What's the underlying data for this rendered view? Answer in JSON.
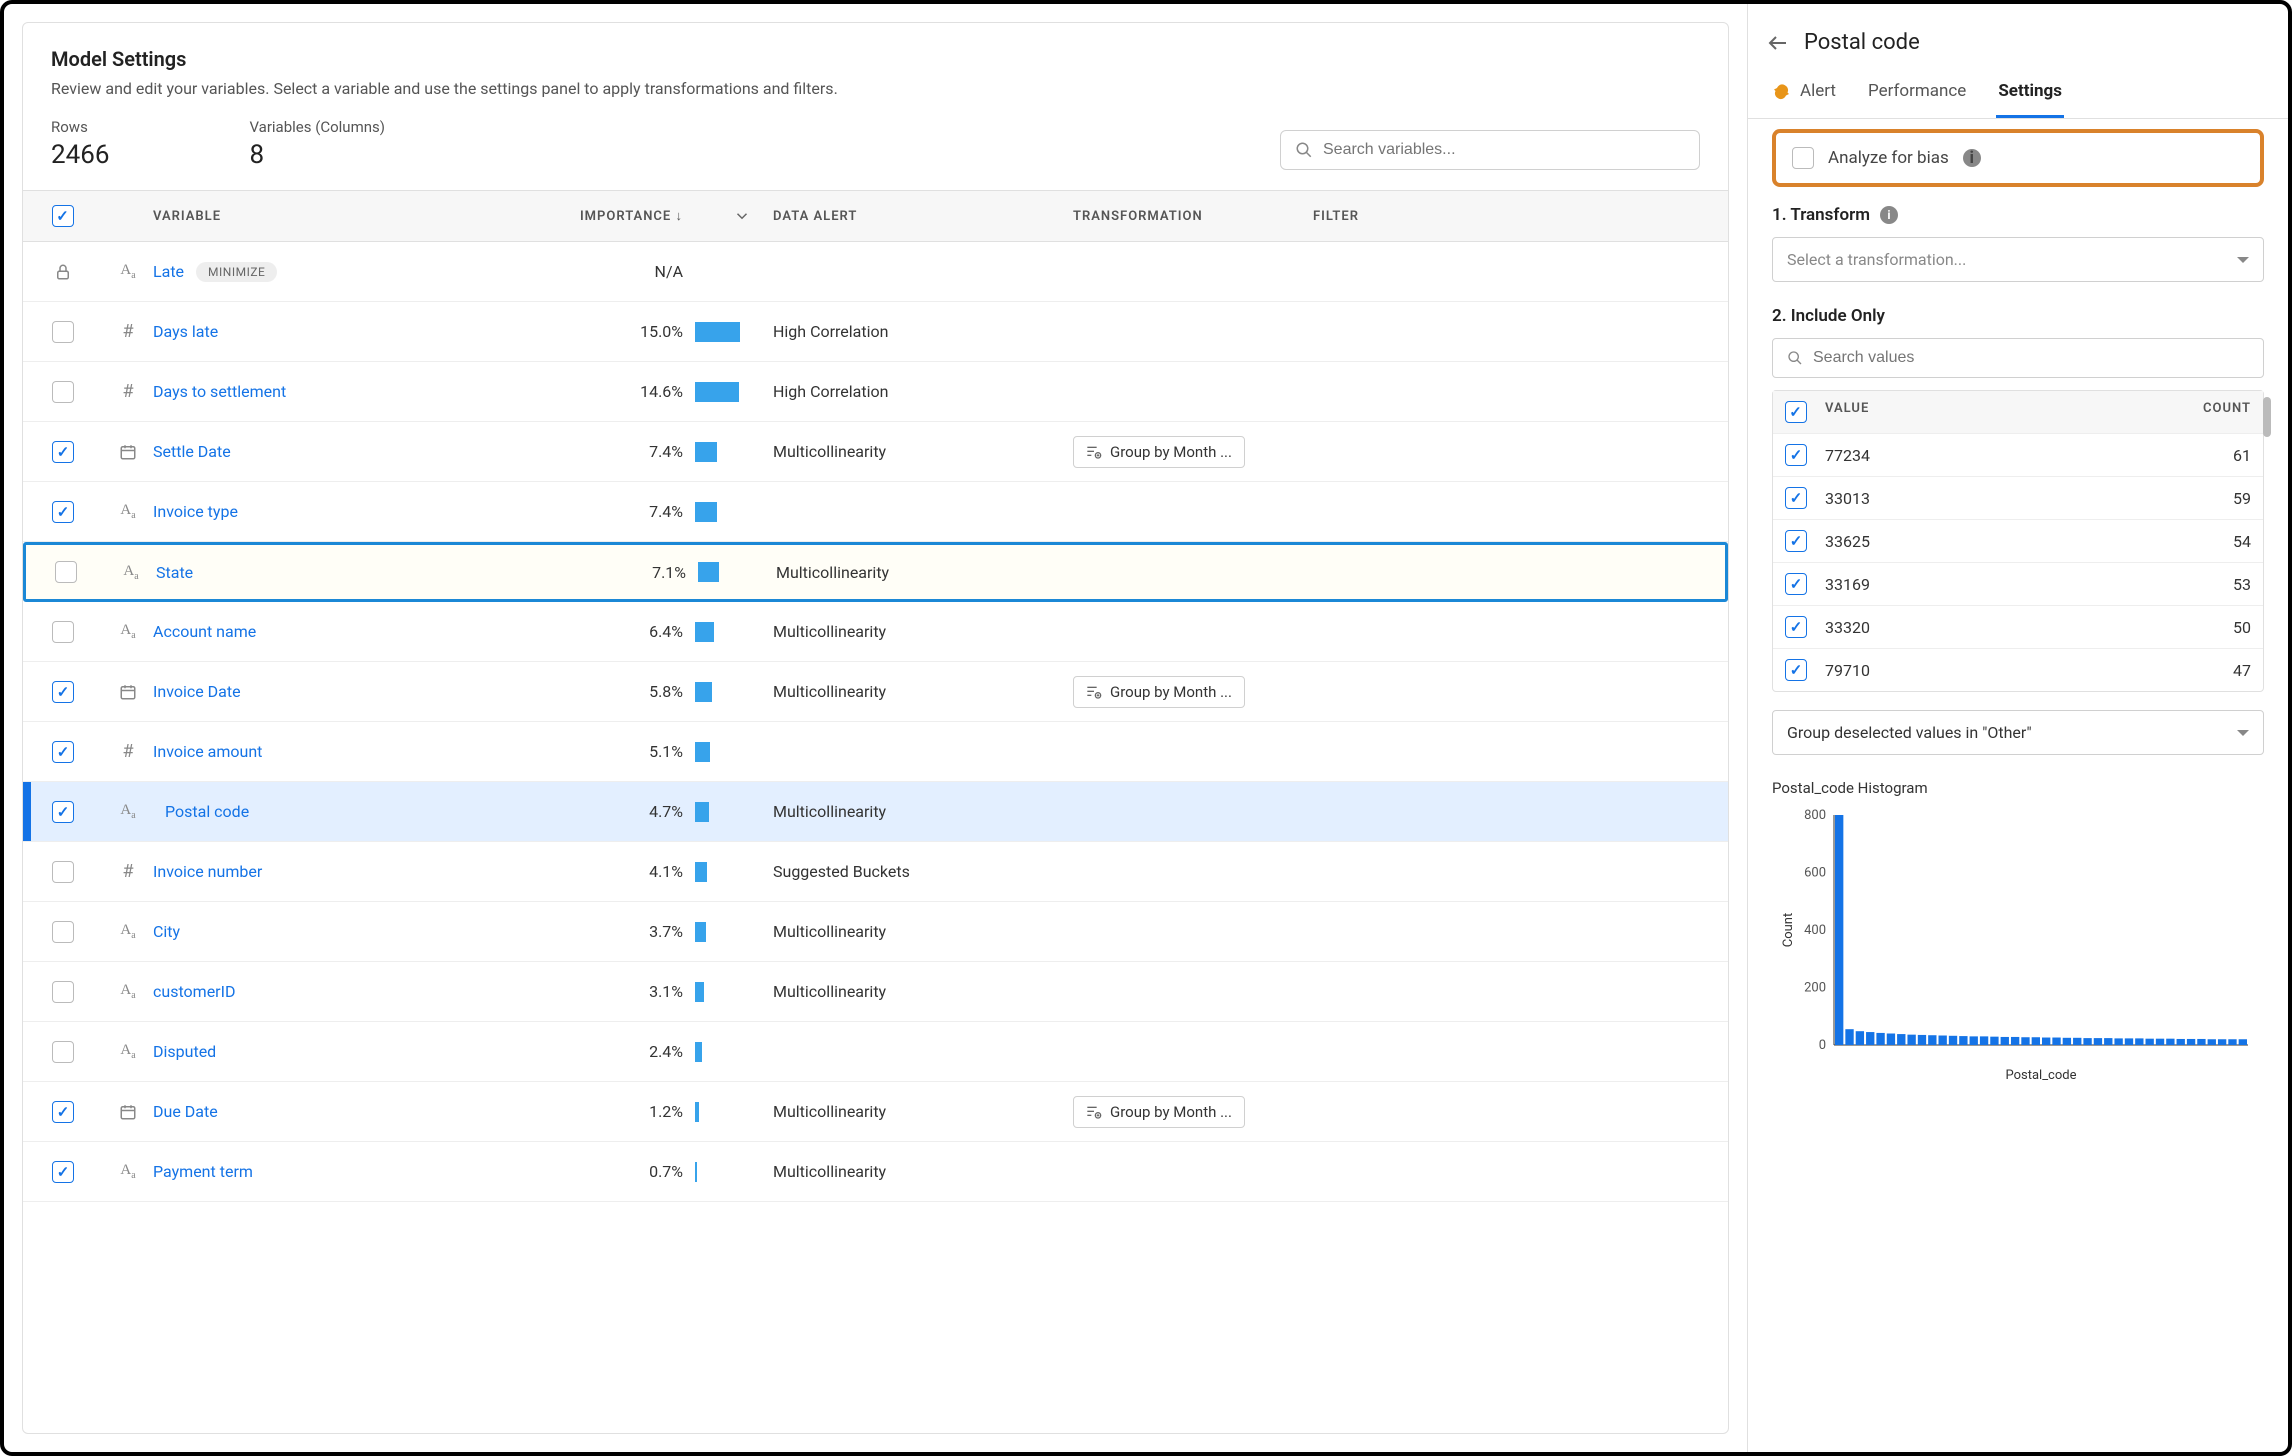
{
  "header": {
    "title": "Model Settings",
    "subtitle": "Review and edit your variables. Select a variable and use the settings panel to apply transformations and filters."
  },
  "stats": {
    "rows_label": "Rows",
    "rows_value": "2466",
    "vars_label": "Variables (Columns)",
    "vars_value": "8"
  },
  "search_placeholder": "Search variables...",
  "columns": {
    "variable": "VARIABLE",
    "importance": "IMPORTANCE ↓",
    "data_alert": "DATA ALERT",
    "transformation": "TRANSFORMATION",
    "filter": "FILTER"
  },
  "rows": [
    {
      "checked": false,
      "locked": true,
      "icon": "Aa",
      "name": "Late",
      "badge": "MINIMIZE",
      "importance": "N/A",
      "bar": 0,
      "alert": "",
      "transformation": ""
    },
    {
      "checked": false,
      "icon": "#",
      "name": "Days late",
      "importance": "15.0%",
      "bar": 15,
      "alert": "High Correlation",
      "transformation": ""
    },
    {
      "checked": false,
      "icon": "#",
      "name": "Days to settlement",
      "importance": "14.6%",
      "bar": 14.6,
      "alert": "High Correlation",
      "transformation": ""
    },
    {
      "checked": true,
      "icon": "cal",
      "name": "Settle Date",
      "importance": "7.4%",
      "bar": 7.4,
      "alert": "Multicollinearity",
      "transformation": "Group by Month ..."
    },
    {
      "checked": true,
      "icon": "Aa",
      "name": "Invoice type",
      "importance": "7.4%",
      "bar": 7.4,
      "alert": "",
      "transformation": ""
    },
    {
      "checked": false,
      "highlighted": true,
      "icon": "Aa",
      "name": "State",
      "importance": "7.1%",
      "bar": 7.1,
      "alert": "Multicollinearity",
      "transformation": ""
    },
    {
      "checked": false,
      "icon": "Aa",
      "name": "Account name",
      "importance": "6.4%",
      "bar": 6.4,
      "alert": "Multicollinearity",
      "transformation": ""
    },
    {
      "checked": true,
      "icon": "cal",
      "name": "Invoice Date",
      "importance": "5.8%",
      "bar": 5.8,
      "alert": "Multicollinearity",
      "transformation": "Group by Month ..."
    },
    {
      "checked": true,
      "icon": "#",
      "name": "Invoice amount",
      "importance": "5.1%",
      "bar": 5.1,
      "alert": "",
      "transformation": ""
    },
    {
      "checked": true,
      "selected": true,
      "icon": "Aa",
      "name": "Postal code",
      "importance": "4.7%",
      "bar": 4.7,
      "alert": "Multicollinearity",
      "transformation": ""
    },
    {
      "checked": false,
      "icon": "#",
      "name": "Invoice number",
      "importance": "4.1%",
      "bar": 4.1,
      "alert": "Suggested Buckets",
      "transformation": ""
    },
    {
      "checked": false,
      "icon": "Aa",
      "name": "City",
      "importance": "3.7%",
      "bar": 3.7,
      "alert": "Multicollinearity",
      "transformation": ""
    },
    {
      "checked": false,
      "icon": "Aa",
      "name": "customerID",
      "importance": "3.1%",
      "bar": 3.1,
      "alert": "Multicollinearity",
      "transformation": ""
    },
    {
      "checked": false,
      "icon": "Aa",
      "name": "Disputed",
      "importance": "2.4%",
      "bar": 2.4,
      "alert": "",
      "transformation": ""
    },
    {
      "checked": true,
      "icon": "cal",
      "name": "Due Date",
      "importance": "1.2%",
      "bar": 1.2,
      "alert": "Multicollinearity",
      "transformation": "Group by Month ..."
    },
    {
      "checked": true,
      "icon": "Aa",
      "name": "Payment term",
      "importance": "0.7%",
      "bar": 0.7,
      "alert": "Multicollinearity",
      "transformation": ""
    }
  ],
  "side": {
    "title": "Postal code",
    "tabs": [
      "Alert",
      "Performance",
      "Settings"
    ],
    "active_tab": "Settings",
    "bias_label": "Analyze for bias",
    "transform_label": "1. Transform",
    "transform_placeholder": "Select a transformation...",
    "include_label": "2. Include Only",
    "search_placeholder": "Search values",
    "value_header": "VALUE",
    "count_header": "COUNT",
    "values": [
      {
        "value": "77234",
        "count": "61"
      },
      {
        "value": "33013",
        "count": "59"
      },
      {
        "value": "33625",
        "count": "54"
      },
      {
        "value": "33169",
        "count": "53"
      },
      {
        "value": "33320",
        "count": "50"
      },
      {
        "value": "79710",
        "count": "47"
      }
    ],
    "group_other": "Group deselected values in \"Other\"",
    "hist_title": "Postal_code Histogram",
    "hist_xlabel": "Postal_code",
    "hist_ylabel": "Count"
  },
  "chart_data": {
    "type": "bar",
    "title": "Postal_code Histogram",
    "xlabel": "Postal_code",
    "ylabel": "Count",
    "ylim": [
      0,
      800
    ],
    "y_ticks": [
      0,
      200,
      400,
      600,
      800
    ],
    "categories_count": 40,
    "values": [
      800,
      55,
      48,
      45,
      42,
      40,
      38,
      36,
      35,
      34,
      33,
      32,
      31,
      30,
      30,
      29,
      28,
      28,
      27,
      27,
      26,
      26,
      25,
      25,
      24,
      24,
      24,
      23,
      23,
      23,
      22,
      22,
      22,
      21,
      21,
      21,
      20,
      20,
      20,
      20
    ],
    "note": "single dominant first bar ~800, long tail of small bars ~20-55; individual x labels not legible"
  }
}
